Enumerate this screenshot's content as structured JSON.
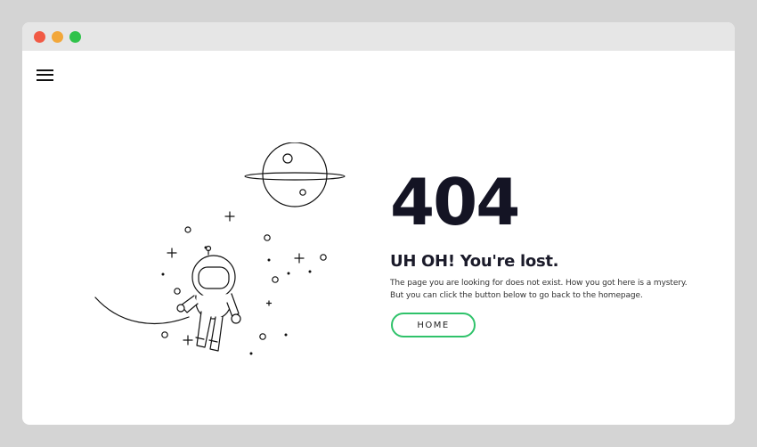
{
  "window": {
    "controls": [
      "close",
      "minimize",
      "maximize"
    ],
    "colors": {
      "close": "#f15a45",
      "minimize": "#f2a73a",
      "maximize": "#2fc24a"
    }
  },
  "menu": {
    "icon": "hamburger-menu-icon"
  },
  "illustration": {
    "icon": "astronaut-space-illustration"
  },
  "error": {
    "code": "404",
    "heading": "UH OH! You're lost.",
    "description_line1": "The page you are looking for does not exist. How you got here is a mystery.",
    "description_line2": "But you can click the button below to go back to the homepage."
  },
  "home_button": {
    "label": "HOME",
    "border_color": "#2fc26a"
  }
}
